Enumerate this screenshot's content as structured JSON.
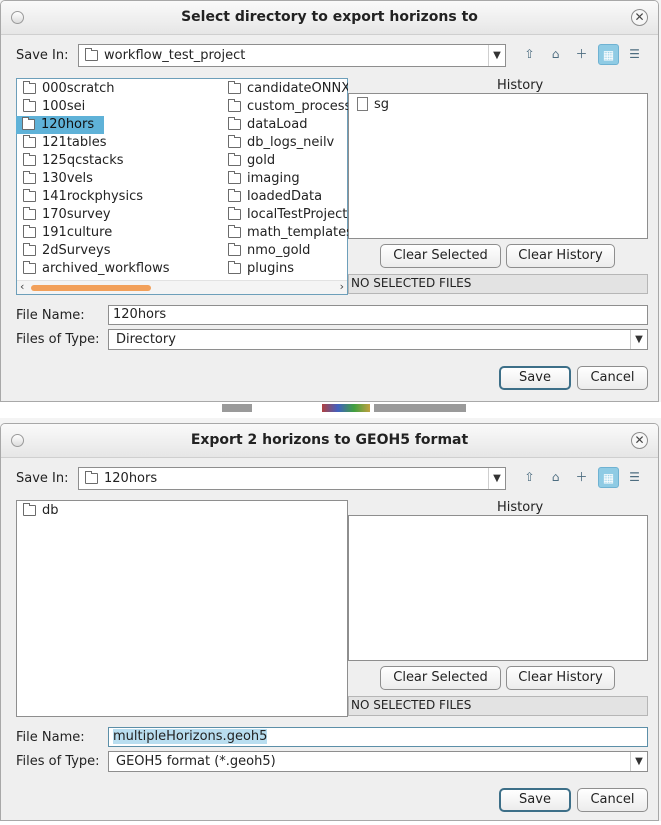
{
  "dialog1": {
    "title": "Select directory to export horizons to",
    "save_in_label": "Save In:",
    "save_in_value": "workflow_test_project",
    "folders_col1": [
      "000scratch",
      "100sei",
      "120hors",
      "121tables",
      "125qcstacks",
      "130vels",
      "141rockphysics",
      "170survey",
      "191culture",
      "2dSurveys",
      "archived_workflows"
    ],
    "folders_col2": [
      "candidateONNXM",
      "custom_process",
      "dataLoad",
      "db_logs_neilv",
      "gold",
      "imaging",
      "loadedData",
      "localTestProject",
      "math_templates",
      "nmo_gold",
      "plugins"
    ],
    "selected_folder": "120hors",
    "history_label": "History",
    "history_items": [
      "sg"
    ],
    "clear_selected": "Clear Selected",
    "clear_history": "Clear History",
    "status": "NO SELECTED FILES",
    "file_name_label": "File Name:",
    "file_name_value": "120hors",
    "files_of_type_label": "Files of Type:",
    "files_of_type_value": "Directory",
    "save": "Save",
    "cancel": "Cancel"
  },
  "dialog2": {
    "title": "Export 2 horizons to GEOH5 format",
    "save_in_label": "Save In:",
    "save_in_value": "120hors",
    "folders": [
      "db"
    ],
    "history_label": "History",
    "clear_selected": "Clear Selected",
    "clear_history": "Clear History",
    "status": "NO SELECTED FILES",
    "file_name_label": "File Name:",
    "file_name_value": "multipleHorizons.geoh5",
    "files_of_type_label": "Files of Type:",
    "files_of_type_value": "GEOH5 format (*.geoh5)",
    "save": "Save",
    "cancel": "Cancel"
  },
  "toolbar_icons": [
    "up-folder-icon",
    "home-icon",
    "new-folder-icon",
    "list-view-icon",
    "details-view-icon"
  ]
}
